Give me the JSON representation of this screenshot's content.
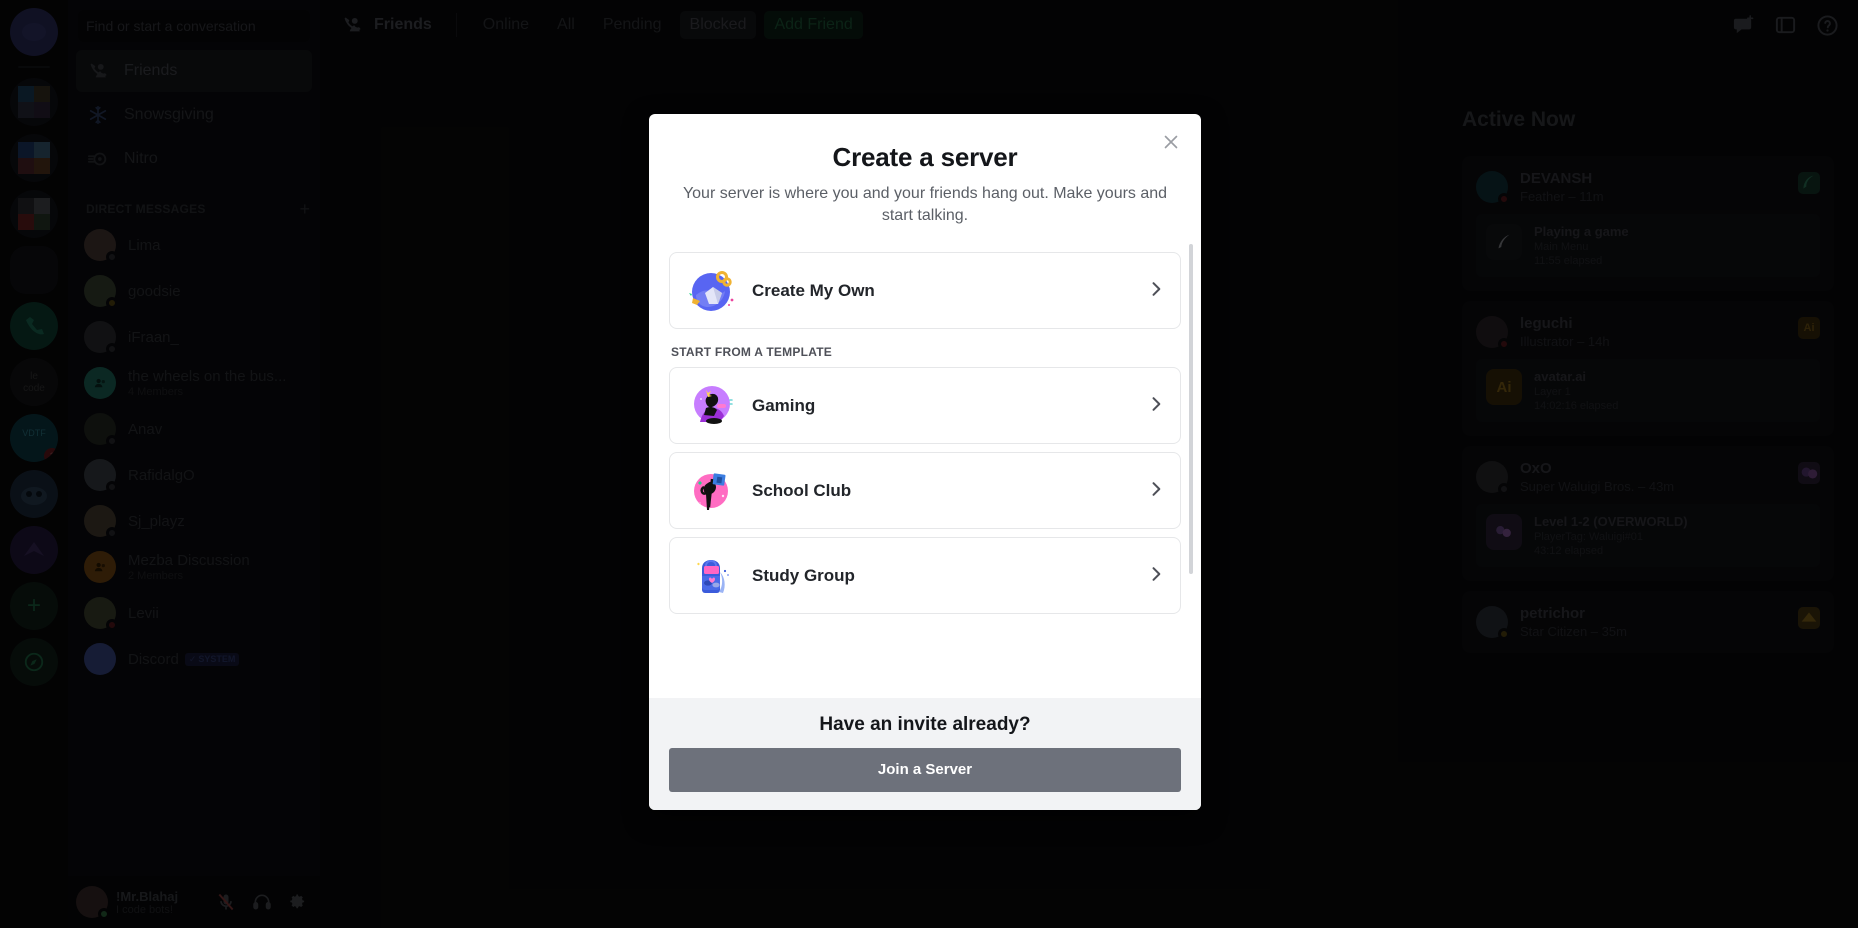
{
  "app": {
    "name": "Discord"
  },
  "sidebar": {
    "search_placeholder": "Find or start a conversation",
    "nav": [
      {
        "label": "Friends",
        "icon": "friends-icon",
        "active": true
      },
      {
        "label": "Snowsgiving",
        "icon": "snowflake-icon",
        "active": false
      },
      {
        "label": "Nitro",
        "icon": "nitro-icon",
        "active": false
      }
    ],
    "dm_header": "DIRECT MESSAGES",
    "dm_add": "+",
    "dms": [
      {
        "name": "Lima",
        "sub": "",
        "status": "offline",
        "avatar": "#4a3b36",
        "group": false
      },
      {
        "name": "goodsie",
        "sub": "",
        "status": "idle",
        "avatar": "#3a4433",
        "group": false
      },
      {
        "name": "iFraan_",
        "sub": "",
        "status": "offline",
        "avatar": "#2e2f33",
        "group": false
      },
      {
        "name": "the wheels on the bus...",
        "sub": "4 Members",
        "status": "none",
        "avatar": "#1d6b5c",
        "group": true
      },
      {
        "name": "Anav",
        "sub": "",
        "status": "offline",
        "avatar": "#252a22",
        "group": false
      },
      {
        "name": "RafidalgO",
        "sub": "",
        "status": "offline",
        "avatar": "#3b4148",
        "group": false
      },
      {
        "name": "Sj_playz",
        "sub": "",
        "status": "offline",
        "avatar": "#4b4034",
        "group": false
      },
      {
        "name": "Mezba Discussion",
        "sub": "2 Members",
        "status": "none",
        "avatar": "#7a4a13",
        "group": true
      },
      {
        "name": "Levii",
        "sub": "",
        "status": "dnd",
        "avatar": "#3f4430",
        "group": false
      },
      {
        "name": "Discord",
        "sub": "",
        "status": "none",
        "avatar": "#3b4a8c",
        "group": false,
        "badge": "SYSTEM",
        "badge_check": "✓"
      }
    ],
    "user": {
      "name": "!Mr.Blahaj",
      "sub": "I code bots!",
      "avatar": "#3a2a2a",
      "controls": [
        {
          "name": "mic-muted-icon"
        },
        {
          "name": "headphones-icon"
        },
        {
          "name": "gear-icon"
        }
      ]
    }
  },
  "topbar": {
    "title": "Friends",
    "title_icon": "friends-icon",
    "tabs": [
      {
        "label": "Online",
        "selected": false
      },
      {
        "label": "All",
        "selected": false
      },
      {
        "label": "Pending",
        "selected": false
      },
      {
        "label": "Blocked",
        "selected": true
      }
    ],
    "add_friend": "Add Friend",
    "right_icons": [
      {
        "name": "new-group-dm-icon"
      },
      {
        "name": "inbox-icon"
      },
      {
        "name": "help-icon"
      }
    ]
  },
  "active_now": {
    "title": "Active Now",
    "entries": [
      {
        "user": "DEVANSH",
        "status_line": "Feather – 11m",
        "presence": "dnd",
        "avatar": "#10343c",
        "corner_icon_color": "#1d4d3d",
        "activity": {
          "title": "Playing a game",
          "detail": "Main Menu",
          "elapsed": "11:55 elapsed",
          "icon_label": "",
          "icon_bg": "#16181c"
        }
      },
      {
        "user": "leguchi",
        "status_line": "Illustrator – 14h",
        "presence": "dnd",
        "avatar": "#2c2429",
        "corner_icon_color": "#4a3610",
        "corner_icon_label": "Ai",
        "activity": {
          "title": "avatar.ai",
          "detail": "Layer 1",
          "elapsed": "14:02:16 elapsed",
          "icon_label": "Ai",
          "icon_bg": "#3b2c0c"
        }
      },
      {
        "user": "OxO",
        "status_line": "Super Waluigi Bros. – 43m",
        "presence": "offline",
        "avatar": "#2b2b2f",
        "corner_icon_color": "#3a2450",
        "activity": {
          "title": "Level 1-2 (OVERWORLD)",
          "detail": "PlayerTag: Waluigi#01",
          "elapsed": "43:12 elapsed",
          "icon_label": "",
          "icon_bg": "#2a2036"
        }
      },
      {
        "user": "petrichor",
        "status_line": "Star Citizen – 35m",
        "presence": "idle",
        "avatar": "#2a3038",
        "corner_icon_color": "#5a4a1a",
        "activity": null
      }
    ]
  },
  "modal": {
    "title": "Create a server",
    "subtitle": "Your server is where you and your friends hang out. Make yours and start talking.",
    "close_icon": "✕",
    "primary_option": {
      "label": "Create My Own",
      "art": "globe-gem-art",
      "chevron": "›"
    },
    "section_label": "START FROM A TEMPLATE",
    "templates": [
      {
        "label": "Gaming",
        "art": "gaming-art",
        "chevron": "›"
      },
      {
        "label": "School Club",
        "art": "school-club-art",
        "chevron": "›"
      },
      {
        "label": "Study Group",
        "art": "study-group-art",
        "chevron": "›"
      }
    ],
    "footer": {
      "title": "Have an invite already?",
      "join_label": "Join a Server"
    }
  },
  "colors": {
    "accent_green": "#248046",
    "modal_bg": "#ffffff",
    "footer_bg": "#f2f3f5",
    "join_button": "#6d717b"
  }
}
